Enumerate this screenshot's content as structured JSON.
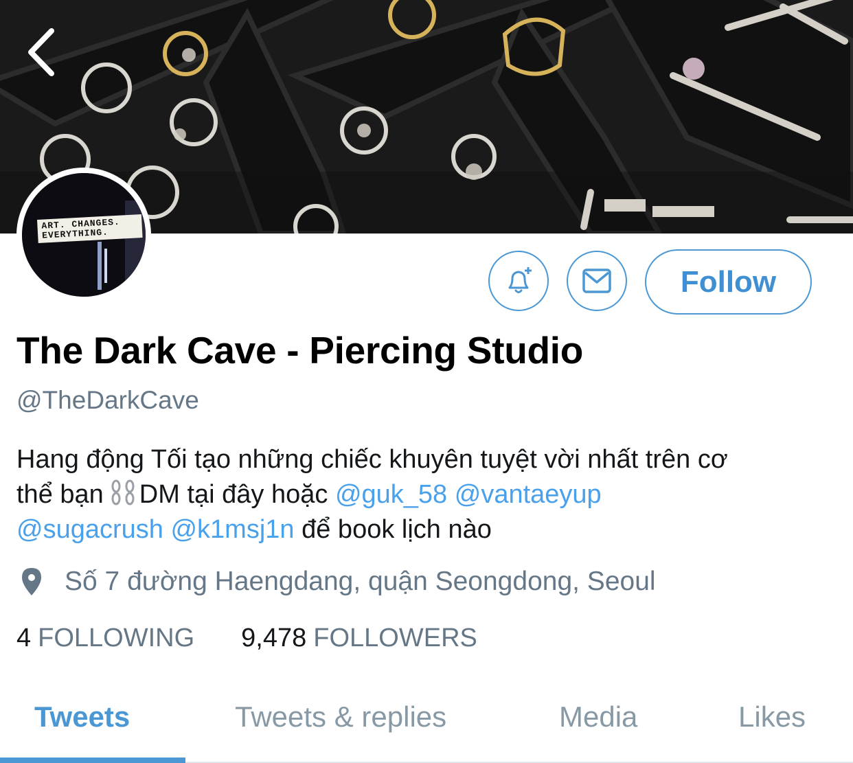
{
  "header": {
    "back_icon": "chevron-left-icon",
    "banner_image": "jewelry-display-tray"
  },
  "avatar": {
    "sign_line1": "ART. CHANGES.",
    "sign_line2": "EVERYTHING."
  },
  "actions": {
    "notify_icon": "bell-plus-icon",
    "message_icon": "envelope-icon",
    "follow_label": "Follow",
    "accent_color": "#4a97d3"
  },
  "profile": {
    "name": "The Dark Cave - Piercing Studio",
    "handle": "@TheDarkCave",
    "bio": {
      "line1": "Hang động Tối tạo những chiếc khuyên tuyệt vời nhất trên cơ",
      "line2_start": "thể bạn",
      "line2_dm": "DM tại đây hoặc",
      "mention1": "@guk_58",
      "mention2": "@vantaeyup",
      "mention3": "@sugacrush",
      "mention4": "@k1msj1n",
      "line3_end": "để book lịch nào"
    },
    "location_icon": "location-pin-icon",
    "location": "Số 7 đường Haengdang, quận Seongdong, Seoul"
  },
  "stats": {
    "following_count": "4",
    "following_label": "FOLLOWING",
    "followers_count": "9,478",
    "followers_label": "FOLLOWERS"
  },
  "tabs": [
    {
      "label": "Tweets",
      "active": true
    },
    {
      "label": "Tweets & replies",
      "active": false
    },
    {
      "label": "Media",
      "active": false
    },
    {
      "label": "Likes",
      "active": false
    }
  ]
}
